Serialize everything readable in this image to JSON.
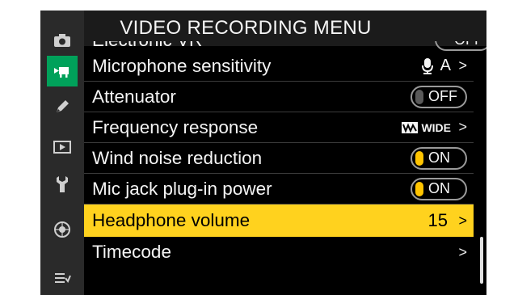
{
  "header": {
    "title": "VIDEO RECORDING MENU"
  },
  "partial_row": {
    "label": "Electronic VR",
    "value": "OFF"
  },
  "sidebar": {
    "items": [
      {
        "icon": "camera-icon"
      },
      {
        "icon": "video-camera-icon",
        "active": true
      },
      {
        "icon": "pencil-icon"
      },
      {
        "icon": "playback-icon"
      },
      {
        "icon": "wrench-icon"
      },
      {
        "icon": "network-icon"
      },
      {
        "icon": "my-menu-icon"
      }
    ]
  },
  "rows": [
    {
      "label": "Microphone sensitivity",
      "value_text": "A",
      "chevron": ">"
    },
    {
      "label": "Attenuator",
      "toggle": "OFF"
    },
    {
      "label": "Frequency response",
      "value_text": "WIDE",
      "chevron": ">"
    },
    {
      "label": "Wind noise reduction",
      "toggle": "ON"
    },
    {
      "label": "Mic jack plug-in power",
      "toggle": "ON"
    },
    {
      "label": "Headphone volume",
      "value_text": "15",
      "chevron": ">",
      "selected": true
    },
    {
      "label": "Timecode",
      "chevron": ">"
    }
  ],
  "colors": {
    "accent_green": "#00a15a",
    "highlight_yellow": "#ffd21e"
  }
}
